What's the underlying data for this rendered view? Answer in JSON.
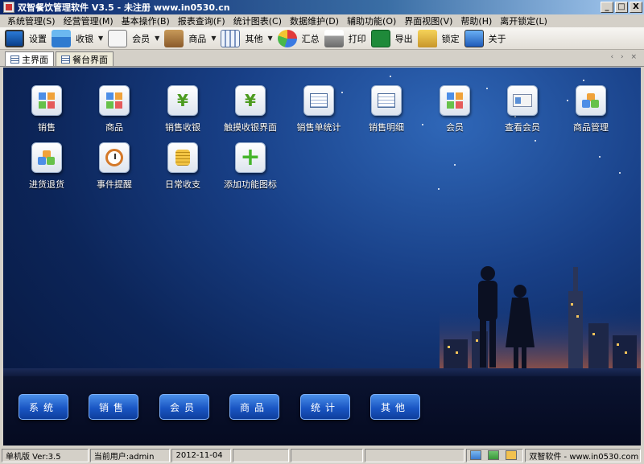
{
  "window": {
    "title": "双智餐饮管理软件 V3.5  - 未注册 www.in0530.cn",
    "minimize": "_",
    "maximize": "□",
    "close": "X"
  },
  "menu": [
    "系统管理(S)",
    "经营管理(M)",
    "基本操作(B)",
    "报表查询(F)",
    "统计图表(C)",
    "数据维护(D)",
    "辅助功能(O)",
    "界面视图(V)",
    "帮助(H)",
    "离开锁定(L)"
  ],
  "toolbar": {
    "settings": "设置",
    "cashier": "收银",
    "member": "会员",
    "goods": "商品",
    "other": "其他",
    "summary": "汇总",
    "print": "打印",
    "export": "导出",
    "lock": "锁定",
    "about": "关于"
  },
  "tabs": [
    "主界面",
    "餐台界面"
  ],
  "tab_arrows": "‹ › ×",
  "shortcuts": {
    "row1": [
      "销售",
      "商品",
      "销售收银",
      "触摸收银界面",
      "销售单统计",
      "销售明细",
      "会员",
      "查看会员",
      "商品管理"
    ],
    "row2": [
      "进货退货",
      "事件提醒",
      "日常收支",
      "添加功能图标"
    ]
  },
  "icon_glyphs": {
    "yen": "¥",
    "plus": "+"
  },
  "categories": [
    "系统",
    "销售",
    "会员",
    "商品",
    "统计",
    "其他"
  ],
  "status": {
    "edition": "单机版 Ver:3.5",
    "user": "当前用户:admin",
    "date": "2012-11-04",
    "brand": "双智软件 - www.in0530.com"
  }
}
